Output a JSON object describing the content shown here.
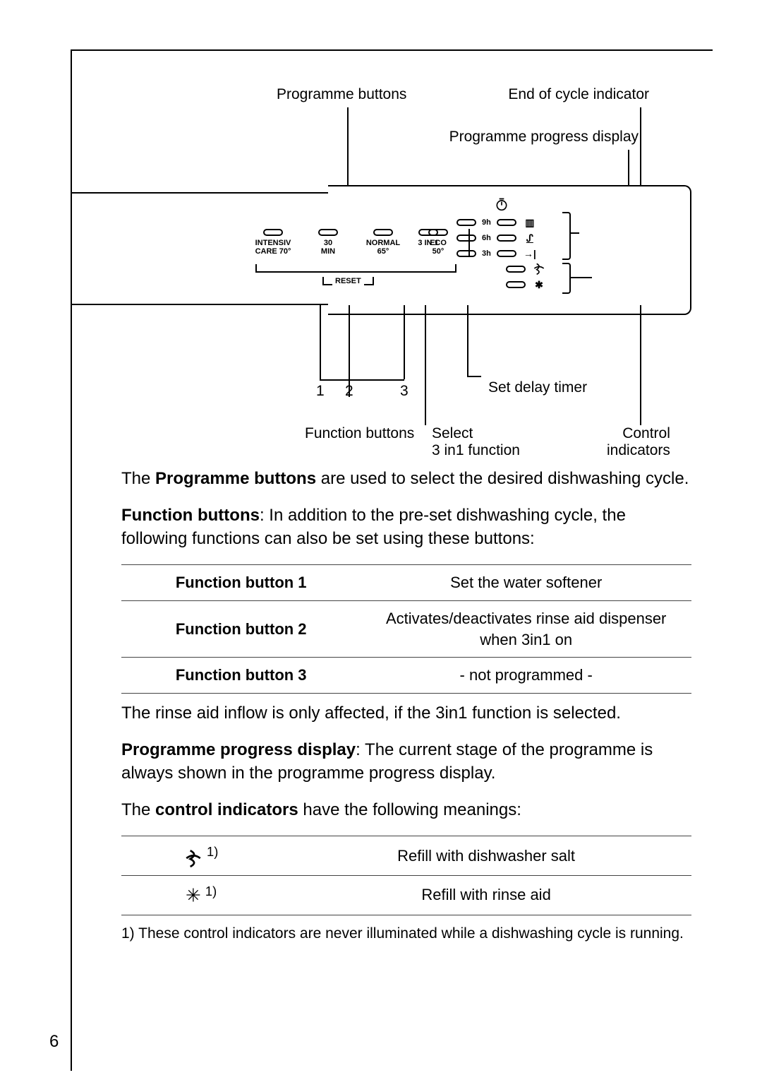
{
  "diagram": {
    "labels": {
      "programme_buttons": "Programme buttons",
      "end_of_cycle": "End of cycle indicator",
      "progress_display": "Programme progress display",
      "set_delay": "Set delay timer",
      "function_buttons": "Function buttons",
      "select_3in1": "Select\n3 in1 function",
      "control_indicators": "Control\nindicators",
      "reset": "RESET",
      "fn_numbers": [
        "1",
        "2",
        "3"
      ]
    },
    "programme_buttons": [
      {
        "top": "INTENSIV",
        "sub": "CARE 70°"
      },
      {
        "top": "30",
        "sub": "MIN"
      },
      {
        "top": "NORMAL",
        "sub": "65°"
      },
      {
        "top": "ECO",
        "sub": "50°"
      }
    ],
    "three_in_one": "3 IN 1",
    "delay_labels": [
      "9h",
      "6h",
      "3h"
    ],
    "progress_icons": [
      "bars",
      "steam",
      "arrow",
      "salt",
      "snow"
    ],
    "clock_icon": "clock"
  },
  "paragraphs": {
    "p1_prefix": "The ",
    "p1_bold": "Programme buttons",
    "p1_rest": " are used to select the desired dishwashing cycle.",
    "p2_bold": "Function buttons",
    "p2_rest": ": In addition to the pre-set dishwashing cycle, the following functions can also be set using these buttons:",
    "p3": "The rinse aid inflow is only affected, if the 3in1 function is selected.",
    "p4_bold": "Programme progress display",
    "p4_rest": ": The current stage of the programme is always shown in the programme progress display.",
    "p5_prefix": "The ",
    "p5_bold": "control indicators",
    "p5_rest": " have the following meanings:"
  },
  "function_table": [
    {
      "name": "Function button 1",
      "desc": "Set the water softener"
    },
    {
      "name": "Function button 2",
      "desc": "Activates/deactivates rinse aid dispenser when 3in1 on"
    },
    {
      "name": "Function button 3",
      "desc": "- not programmed -"
    }
  ],
  "indicator_table": [
    {
      "icon": "salt",
      "sup": "1)",
      "desc": "Refill with dishwasher salt"
    },
    {
      "icon": "snow",
      "sup": "1)",
      "desc": "Refill with rinse aid"
    }
  ],
  "footnote": "1) These control indicators are never illuminated while a dishwashing cycle is running.",
  "page_number": "6"
}
